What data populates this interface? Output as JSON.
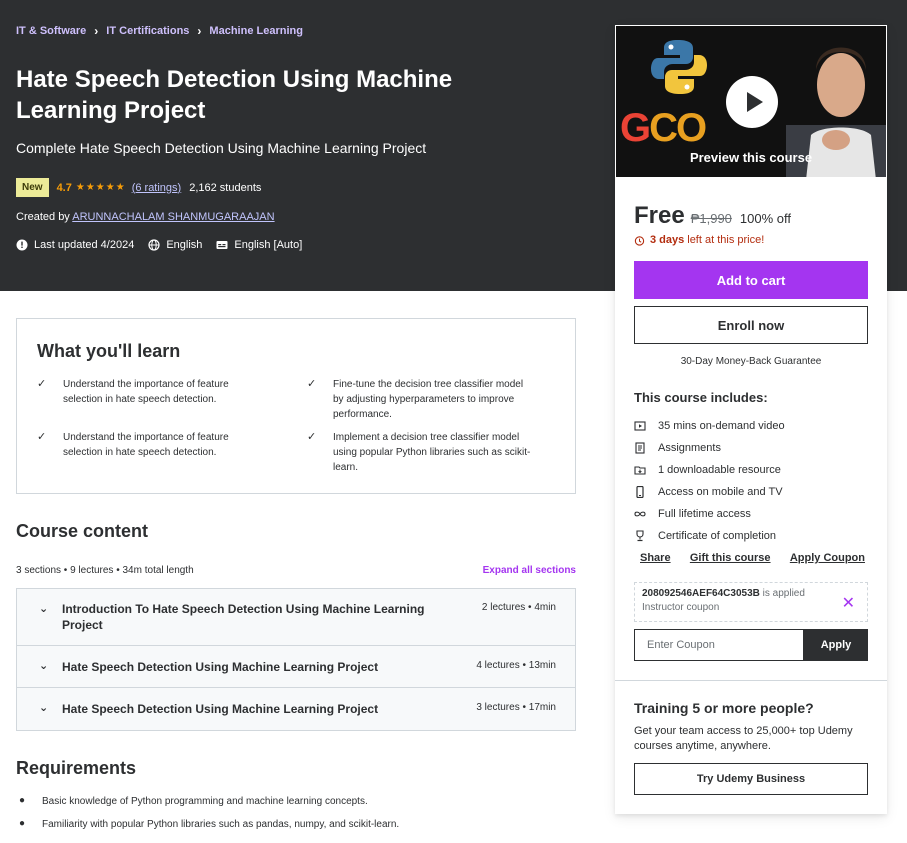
{
  "breadcrumb": [
    "IT & Software",
    "IT Certifications",
    "Machine Learning"
  ],
  "course": {
    "title": "Hate Speech Detection Using Machine Learning Project",
    "subtitle": "Complete Hate Speech Detection Using Machine Learning Project",
    "badge": "New",
    "rating": "4.7",
    "ratings_count": "(6 ratings)",
    "students": "2,162 students",
    "created_by_label": "Created by",
    "instructor": "ARUNNACHALAM SHANMUGARAAJAN",
    "last_updated": "Last updated 4/2024",
    "language": "English",
    "captions": "English [Auto]"
  },
  "sidebar": {
    "preview_label": "Preview this course",
    "price": "Free",
    "original_price": "₱1,990",
    "discount": "100% off",
    "timer_bold": "3 days",
    "timer_text": "left at this price!",
    "add_to_cart": "Add to cart",
    "enroll_now": "Enroll now",
    "guarantee": "30-Day Money-Back Guarantee",
    "includes_title": "This course includes:",
    "includes": [
      {
        "icon": "video-icon",
        "label": "35 mins on-demand video"
      },
      {
        "icon": "assignment-icon",
        "label": "Assignments"
      },
      {
        "icon": "folder-download-icon",
        "label": "1 downloadable resource"
      },
      {
        "icon": "mobile-icon",
        "label": "Access on mobile and TV"
      },
      {
        "icon": "infinity-icon",
        "label": "Full lifetime access"
      },
      {
        "icon": "trophy-icon",
        "label": "Certificate of completion"
      }
    ],
    "links": {
      "share": "Share",
      "gift": "Gift this course",
      "apply_coupon": "Apply Coupon"
    },
    "coupon_code": "208092546AEF64C3053B",
    "coupon_applied": "is applied",
    "coupon_type": "Instructor coupon",
    "coupon_placeholder": "Enter Coupon",
    "apply_button": "Apply",
    "team_title": "Training 5 or more people?",
    "team_text": "Get your team access to 25,000+ top Udemy courses anytime, anywhere.",
    "business_button": "Try Udemy Business"
  },
  "learn": {
    "title": "What you'll learn",
    "items": [
      "Understand the importance of feature selection in hate speech detection.",
      "Fine-tune the decision tree classifier model by adjusting hyperparameters to improve performance.",
      "Understand the importance of feature selection in hate speech detection.",
      "Implement a decision tree classifier model using popular Python libraries such as scikit-learn."
    ]
  },
  "content": {
    "title": "Course content",
    "summary": "3 sections • 9 lectures • 34m total length",
    "expand_all": "Expand all sections",
    "sections": [
      {
        "title": "Introduction To Hate Speech Detection Using Machine Learning Project",
        "info": "2 lectures • 4min"
      },
      {
        "title": "Hate Speech Detection Using Machine Learning Project",
        "info": "4 lectures • 13min"
      },
      {
        "title": "Hate Speech Detection Using Machine Learning Project",
        "info": "3 lectures • 17min"
      }
    ]
  },
  "requirements": {
    "title": "Requirements",
    "items": [
      "Basic knowledge of Python programming and machine learning concepts.",
      "Familiarity with popular Python libraries such as pandas, numpy, and scikit-learn."
    ]
  },
  "colors": {
    "header_bg": "#2d2f31",
    "accent_purple": "#a435f0",
    "star": "#f69c08",
    "link_lavender": "#c0c4fc",
    "badge_bg": "#eceb98"
  }
}
